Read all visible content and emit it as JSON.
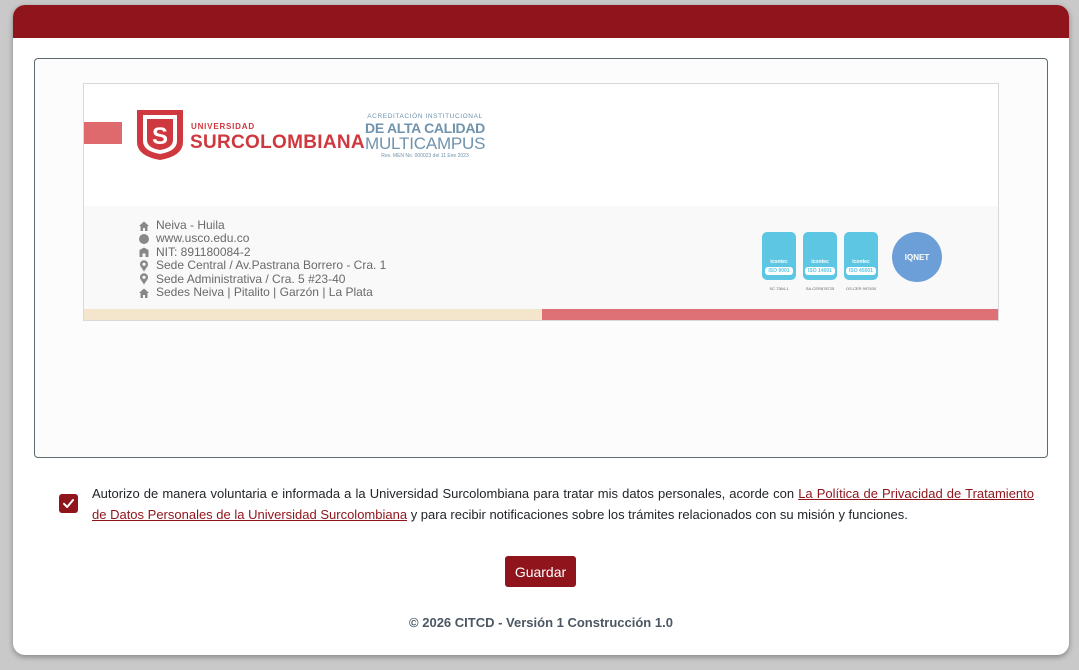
{
  "letterhead": {
    "university_small": "UNIVERSIDAD",
    "university_name": "SURCOLOMBIANA",
    "accreditation": {
      "line1": "ACREDITACIÓN INSTITUCIONAL",
      "line2": "DE ALTA CALIDAD",
      "line3": "MULTICAMPUS",
      "line4": "Res. MEN No. 000023 del 11 Ene 2023"
    },
    "contact": [
      {
        "icon": "home-icon",
        "text": "Neiva - Huila"
      },
      {
        "icon": "globe-icon",
        "text": "www.usco.edu.co"
      },
      {
        "icon": "building-icon",
        "text": "NIT: 891180084-2"
      },
      {
        "icon": "location-pin-icon",
        "text": "Sede Central / Av.Pastrana Borrero - Cra. 1"
      },
      {
        "icon": "location-pin-icon",
        "text": "Sede Administrativa / Cra. 5 #23-40"
      },
      {
        "icon": "home-icon",
        "text": "Sedes Neiva | Pitalito | Garzón | La Plata"
      }
    ],
    "certifications": [
      {
        "brand": "icontec",
        "label": "ISO 9001",
        "caption": "SC 7384-1"
      },
      {
        "brand": "icontec",
        "label": "ISO 14001",
        "caption": "SA-CER878725"
      },
      {
        "brand": "icontec",
        "label": "ISO 45001",
        "caption": "OS-CER 997530"
      }
    ],
    "iqnet": "IQNET",
    "colors": {
      "brand_red": "#d0383f",
      "stripe_cream": "#f4e6cd",
      "stripe_red": "#de7175",
      "accreditation_blue": "#6f93ad"
    }
  },
  "consent": {
    "checked": true,
    "text_before": "Autorizo de manera voluntaria e informada a la Universidad Surcolombiana para tratar mis datos personales, acorde con ",
    "link_text": "La Política de Privacidad de Tratamiento de Datos Personales de la Universidad Surcolombiana",
    "text_after": " y para recibir notificaciones sobre los trámites relacionados con su misión y funciones."
  },
  "actions": {
    "save_label": "Guardar"
  },
  "footer": {
    "text": "© 2026 CITCD - Versión 1 Construcción 1.0"
  },
  "theme": {
    "primary": "#8f141b"
  }
}
